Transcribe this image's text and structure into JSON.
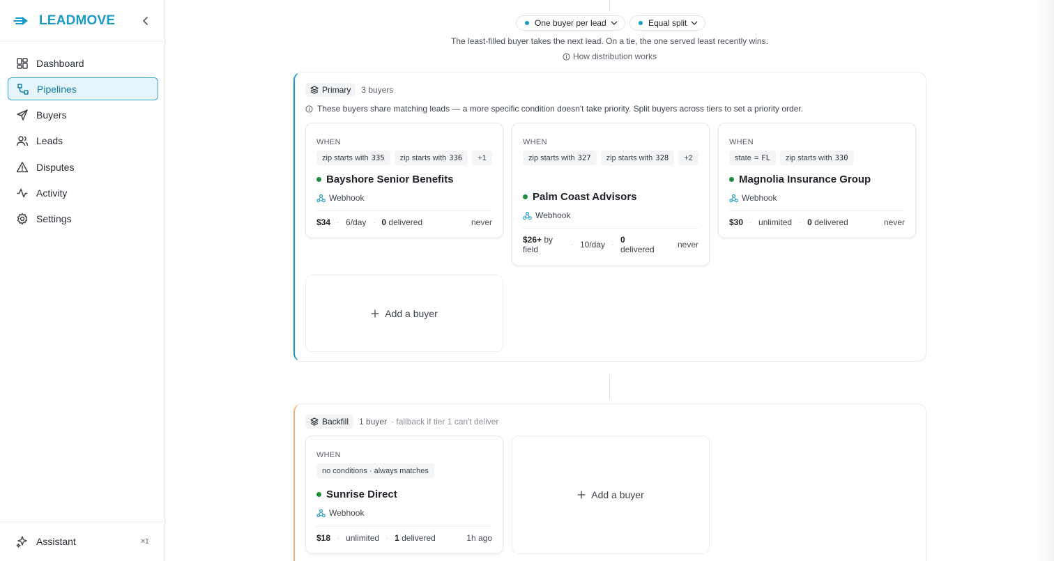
{
  "brand": {
    "name": "LEADMOVE",
    "accent": "#1a9bc4"
  },
  "nav": {
    "items": [
      {
        "label": "Dashboard",
        "icon": "dashboard-icon"
      },
      {
        "label": "Pipelines",
        "icon": "pipelines-icon"
      },
      {
        "label": "Buyers",
        "icon": "send-icon"
      },
      {
        "label": "Leads",
        "icon": "users-icon"
      },
      {
        "label": "Disputes",
        "icon": "alert-triangle-icon"
      },
      {
        "label": "Activity",
        "icon": "activity-icon"
      },
      {
        "label": "Settings",
        "icon": "gear-icon"
      }
    ],
    "active": "Pipelines"
  },
  "assistant": {
    "label": "Assistant",
    "shortcut": "⌘I"
  },
  "distribution": {
    "mode": "One buyer per lead",
    "split": "Equal split",
    "description": "The least-filled buyer takes the next lead. On a tie, the one served least recently wins.",
    "how_link": "How distribution works"
  },
  "primary": {
    "label": "Primary",
    "count": "3 buyers",
    "note": "These buyers share matching leads — a more specific condition doesn't take priority. Split buyers across tiers to set a priority order.",
    "add_label": "Add a buyer",
    "cards": [
      {
        "when": "WHEN",
        "chips": [
          {
            "field": "zip",
            "op": "starts with",
            "value": "335"
          },
          {
            "field": "zip",
            "op": "starts with",
            "value": "336"
          },
          {
            "more": "+1"
          }
        ],
        "name": "Bayshore Senior Benefits",
        "delivery": "Webhook",
        "price": "$34",
        "cap": "6/day",
        "delivered_count": "0",
        "delivered_label": "delivered",
        "last": "never"
      },
      {
        "when": "WHEN",
        "chips": [
          {
            "field": "zip",
            "op": "starts with",
            "value": "327"
          },
          {
            "field": "zip",
            "op": "starts with",
            "value": "328"
          },
          {
            "more": "+2"
          }
        ],
        "name": "Palm Coast Advisors",
        "delivery": "Webhook",
        "price": "$26+",
        "price_suffix": "by field",
        "cap": "10/day",
        "delivered_count": "0",
        "delivered_label": "delivered",
        "last": "never"
      },
      {
        "when": "WHEN",
        "chips": [
          {
            "field": "state",
            "op": "=",
            "value": "FL"
          },
          {
            "field": "zip",
            "op": "starts with",
            "value": "330"
          }
        ],
        "name": "Magnolia Insurance Group",
        "delivery": "Webhook",
        "price": "$30",
        "cap": "unlimited",
        "delivered_count": "0",
        "delivered_label": "delivered",
        "last": "never"
      }
    ]
  },
  "backfill": {
    "label": "Backfill",
    "count": "1 buyer",
    "fallback": "· fallback if tier 1 can't deliver",
    "add_label": "Add a buyer",
    "cards": [
      {
        "when": "WHEN",
        "chip_text": "no conditions · always matches",
        "name": "Sunrise Direct",
        "delivery": "Webhook",
        "price": "$18",
        "cap": "unlimited",
        "delivered_count": "1",
        "delivered_label": "delivered",
        "last": "1h ago"
      }
    ]
  },
  "colors": {
    "active_status": "#1e8e3e",
    "primary_tier": "#1a9bc4",
    "backfill_tier": "#f0b27a"
  }
}
